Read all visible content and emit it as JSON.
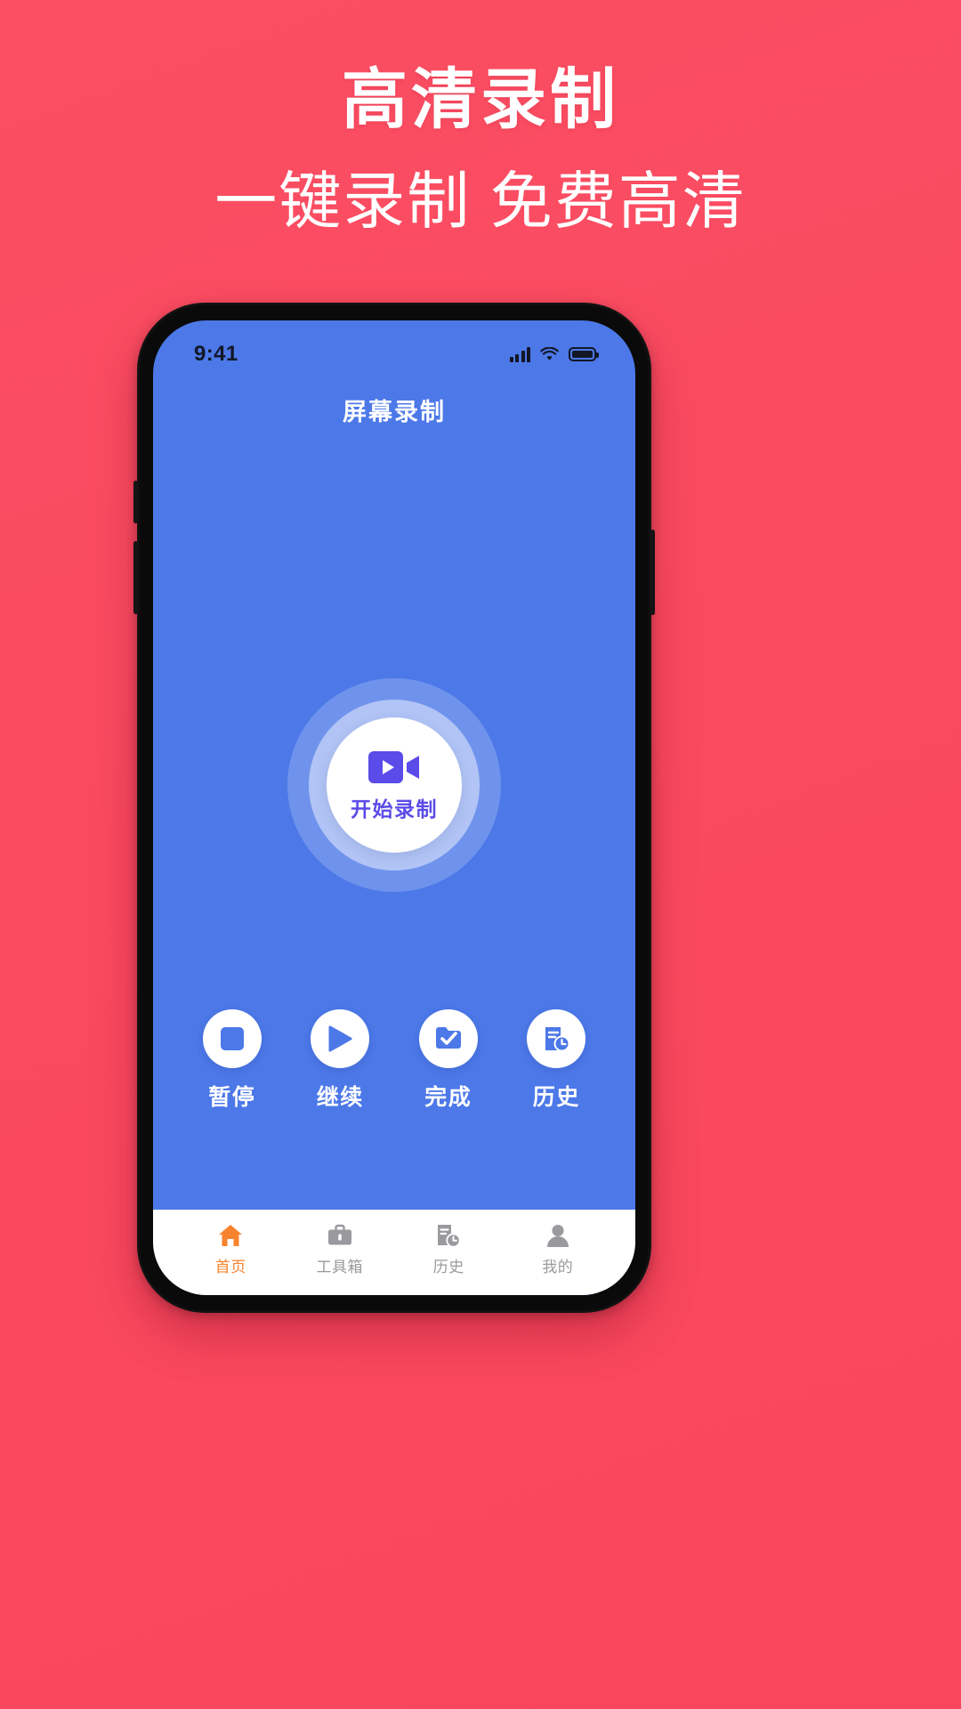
{
  "promo": {
    "title": "高清录制",
    "subtitle": "一键录制 免费高清",
    "bg_color": "#FB4E63",
    "text_color": "#FFFFFF"
  },
  "phone": {
    "frame_color": "#0A0A0A",
    "screen_bg": "#4C78E8"
  },
  "status_bar": {
    "time": "9:41",
    "icons": [
      "signal-bars-icon",
      "wifi-icon",
      "battery-icon"
    ],
    "icon_color": "#121726"
  },
  "app": {
    "header_title": "屏幕录制",
    "accent_purple": "#5B4BE8",
    "accent_orange": "#F8832E"
  },
  "record_button": {
    "label": "开始录制",
    "icon": "video-camera-play-icon",
    "icon_color": "#5B4BE8",
    "circle_color": "#FFFFFF"
  },
  "actions": [
    {
      "label": "暂停",
      "icon": "stop-square-icon"
    },
    {
      "label": "继续",
      "icon": "play-triangle-icon"
    },
    {
      "label": "完成",
      "icon": "folder-check-icon"
    },
    {
      "label": "历史",
      "icon": "document-clock-icon"
    }
  ],
  "tabbar": {
    "items": [
      {
        "label": "首页",
        "icon": "home-icon",
        "active": true
      },
      {
        "label": "工具箱",
        "icon": "toolbox-icon",
        "active": false
      },
      {
        "label": "历史",
        "icon": "document-clock-icon",
        "active": false
      },
      {
        "label": "我的",
        "icon": "person-icon",
        "active": false
      }
    ]
  }
}
